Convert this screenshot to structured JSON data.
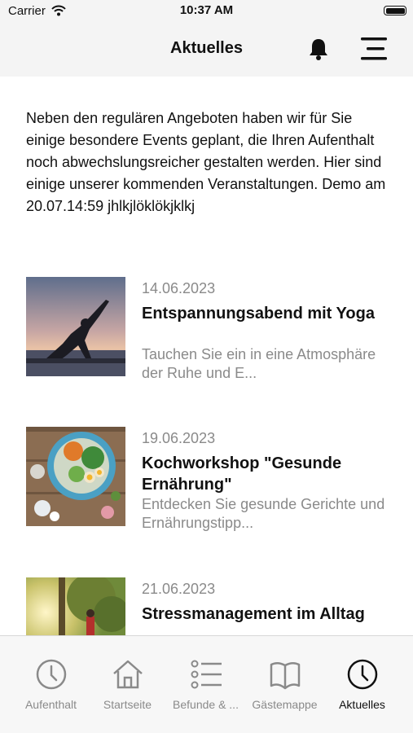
{
  "status_bar": {
    "carrier": "Carrier",
    "time": "10:37 AM"
  },
  "header": {
    "title": "Aktuelles"
  },
  "intro": {
    "text": "Neben den regulären Angeboten haben wir für Sie einige besondere Events geplant, die Ihren Aufenthalt noch abwechslungsreicher gestalten werden. Hier sind einige unserer kommenden Veranstaltungen. Demo am 20.07.14:59 jhlkjlöklökjklkj"
  },
  "events": [
    {
      "date": "14.06.2023",
      "title": "Entspannungsabend mit Yoga",
      "description": "Tauchen Sie ein in eine Atmosphäre der Ruhe und E..."
    },
    {
      "date": "19.06.2023",
      "title": "Kochworkshop \"Gesunde Ernährung\"",
      "description": "Entdecken Sie gesunde Gerichte und Ernährungstipp..."
    },
    {
      "date": "21.06.2023",
      "title": "Stressmanagement im Alltag",
      "description": ""
    }
  ],
  "tabs": [
    {
      "label": "Aufenthalt",
      "icon": "clock-icon"
    },
    {
      "label": "Startseite",
      "icon": "home-icon"
    },
    {
      "label": "Befunde & ...",
      "icon": "list-icon"
    },
    {
      "label": "Gästemappe",
      "icon": "book-icon"
    },
    {
      "label": "Aktuelles",
      "icon": "clock-icon"
    }
  ],
  "colors": {
    "header_bg": "#f4f4f4",
    "tab_inactive": "#8a8a8a",
    "tab_active": "#111111",
    "date_gray": "#8a8a8a"
  }
}
